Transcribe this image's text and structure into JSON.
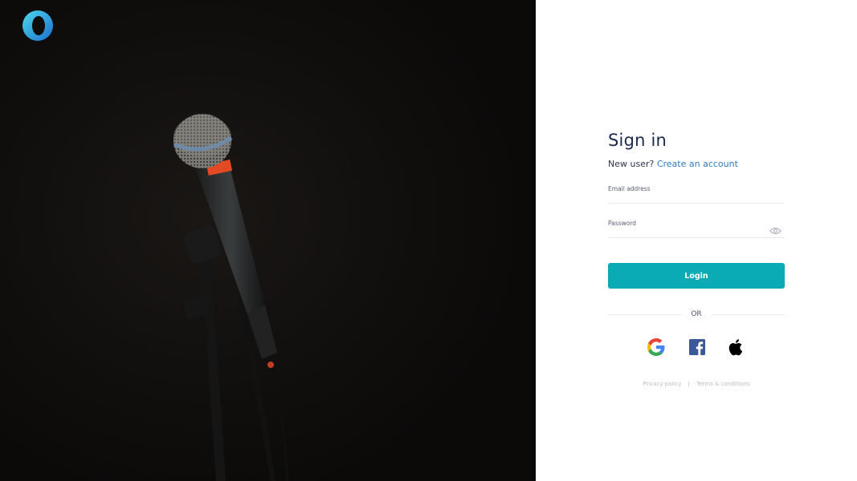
{
  "brand": {
    "logo_icon": "o-ring-logo-icon",
    "accent": "#0aabb5"
  },
  "hero": {
    "image": "microphone-on-stand-photo",
    "background": "#0e0c0b"
  },
  "signin": {
    "title": "Sign in",
    "new_user_text": "New user?",
    "create_account_link": "Create an account",
    "email_label": "Email address",
    "email_value": "",
    "password_label": "Password",
    "password_value": "",
    "password_toggle_icon": "eye-icon",
    "login_button": "Login",
    "or_text": "OR",
    "social": [
      {
        "name": "Google",
        "icon": "google-icon"
      },
      {
        "name": "Facebook",
        "icon": "facebook-icon"
      },
      {
        "name": "Apple",
        "icon": "apple-icon"
      }
    ],
    "footer": {
      "privacy": "Privacy policy",
      "separator": "|",
      "terms": "Terms & conditions"
    }
  },
  "colors": {
    "title": "#1d2a4d",
    "link": "#2f7bc1",
    "button": "#0aabb5"
  }
}
